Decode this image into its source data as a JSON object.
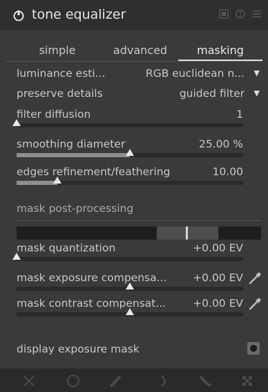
{
  "header": {
    "title": "tone equalizer",
    "icons": [
      "power-icon",
      "presets-icon",
      "reset-icon",
      "menu-icon"
    ]
  },
  "tabs": [
    {
      "label": "simple"
    },
    {
      "label": "advanced"
    },
    {
      "label": "masking",
      "active": true
    }
  ],
  "settings": {
    "luminance_estimator": {
      "label": "luminance esti...",
      "value": "RGB euclidean n..."
    },
    "preserve_details": {
      "label": "preserve details",
      "value": "guided filter"
    },
    "filter_diffusion": {
      "label": "filter diffusion",
      "value": "1",
      "fraction": 0.0
    },
    "smoothing_diameter": {
      "label": "smoothing diameter",
      "value": "25.00 %",
      "fraction": 0.5
    },
    "edges_refinement": {
      "label": "edges refinement/feathering",
      "value": "10.00",
      "fraction": 0.18
    }
  },
  "post_processing": {
    "title": "mask post-processing",
    "mask_quantization": {
      "label": "mask quantization",
      "value": "+0.00 EV",
      "fraction": 0.0
    },
    "mask_exposure": {
      "label": "mask exposure compensa...",
      "value": "+0.00 EV",
      "fraction": 0.5
    },
    "mask_contrast": {
      "label": "mask contrast compensat...",
      "value": "+0.00 EV",
      "fraction": 0.5
    }
  },
  "display_mask": {
    "label": "display exposure mask"
  },
  "footer": {
    "icons": [
      "close-x-icon",
      "circle-icon",
      "brush-icon",
      "curve-mask-icon",
      "drawn-param-icon",
      "raster-mask-icon"
    ]
  },
  "colors": {
    "background": "#3a3a3a",
    "header": "#2f2f2f",
    "text": "#c8c8c8",
    "accent": "#e8e8e8"
  }
}
